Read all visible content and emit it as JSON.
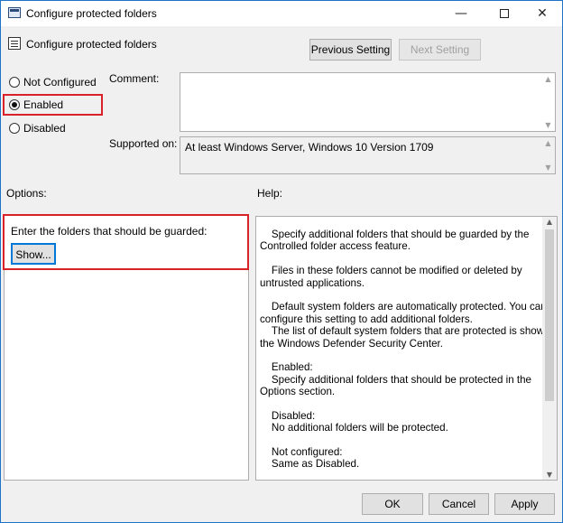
{
  "window": {
    "title": "Configure protected folders",
    "controls": {
      "minimize": "—",
      "close": "✕"
    }
  },
  "header": {
    "policy_name": "Configure protected folders",
    "previous_setting": "Previous Setting",
    "next_setting": "Next Setting"
  },
  "state": {
    "options": [
      "Not Configured",
      "Enabled",
      "Disabled"
    ],
    "selected": "Enabled"
  },
  "comment": {
    "label": "Comment:",
    "value": ""
  },
  "supported_on": {
    "label": "Supported on:",
    "value": "At least Windows Server, Windows 10 Version 1709"
  },
  "options": {
    "label": "Options:",
    "prompt": "Enter the folders that should be guarded:",
    "show_button": "Show..."
  },
  "help": {
    "label": "Help:",
    "lines": [
      "    Specify additional folders that should be guarded by the",
      "Controlled folder access feature.",
      "",
      "    Files in these folders cannot be modified or deleted by",
      "untrusted applications.",
      "",
      "    Default system folders are automatically protected. You can",
      "configure this setting to add additional folders.",
      "    The list of default system folders that are protected is shown in",
      "the Windows Defender Security Center.",
      "",
      "    Enabled:",
      "    Specify additional folders that should be protected in the",
      "Options section.",
      "",
      "    Disabled:",
      "    No additional folders will be protected.",
      "",
      "    Not configured:",
      "    Same as Disabled."
    ]
  },
  "footer": {
    "ok": "OK",
    "cancel": "Cancel",
    "apply": "Apply"
  },
  "colors": {
    "highlight": "#d9212a",
    "focus": "#0078d7",
    "window_border": "#1c73c8"
  }
}
